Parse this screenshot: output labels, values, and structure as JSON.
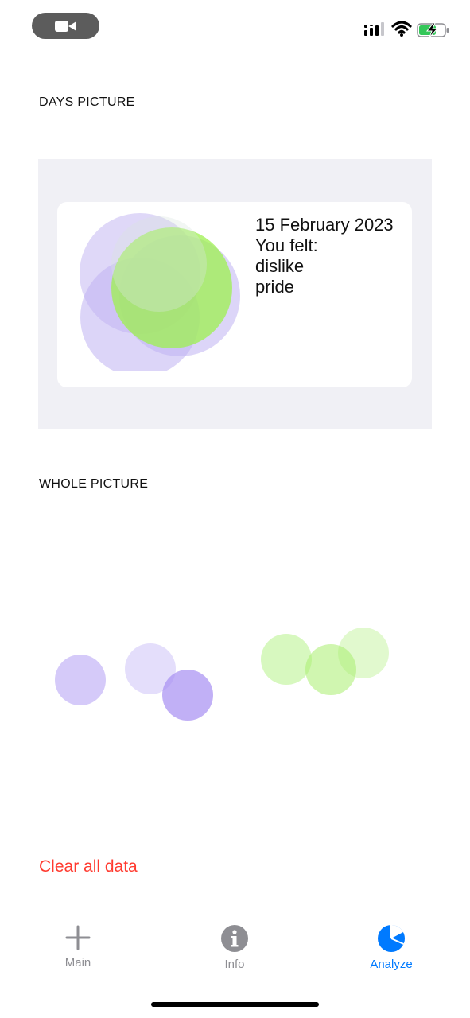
{
  "status_bar": {
    "camera_icon": "video-camera-icon",
    "signal_icon": "cellular-signal-icon",
    "wifi_icon": "wifi-icon",
    "battery_icon": "battery-charging-icon"
  },
  "days_section": {
    "header": "DAYS PICTURE",
    "date": "15 February 2023",
    "felt_label": "You felt:",
    "emotions": [
      "dislike",
      "pride"
    ]
  },
  "whole_section": {
    "header": "WHOLE PICTURE"
  },
  "actions": {
    "clear_label": "Clear all data"
  },
  "tab_bar": {
    "tabs": [
      {
        "label": "Main",
        "icon": "plus-icon",
        "active": false
      },
      {
        "label": "Info",
        "icon": "info-icon",
        "active": false
      },
      {
        "label": "Analyze",
        "icon": "pie-chart-icon",
        "active": true
      }
    ]
  },
  "colors": {
    "accent": "#007aff",
    "destructive": "#ff3b30",
    "inactive": "#8e8e93",
    "lavender": "#b9a7f5",
    "lime": "#9ff05a",
    "panel": "#f0f0f5"
  }
}
